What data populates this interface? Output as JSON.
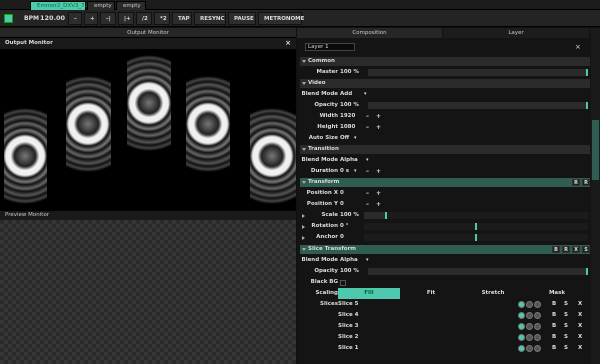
{
  "tabs": [
    {
      "label": "Emmer2_DXV3_720p",
      "active": true
    },
    {
      "label": "empty"
    },
    {
      "label": "empty"
    }
  ],
  "transport": {
    "bpm_label": "BPM",
    "bpm": "120.00",
    "minus": "–",
    "plus": "+",
    "decrement": "–|",
    "increment": "|+",
    "half": "/2",
    "double": "*2",
    "tap": "TAP",
    "resync": "RESYNC",
    "pause": "PAUSE",
    "metronome": "METRONOME"
  },
  "output": {
    "header": "Output Monitor",
    "panel_title": "Output Monitor",
    "close": "×",
    "preview": "Preview Monitor"
  },
  "panel": {
    "tab_composition": "Composition",
    "tab_layer": "Layer",
    "layer_name": "Layer 1",
    "close": "×"
  },
  "common": {
    "title": "Common",
    "master_label": "Master",
    "master_value": "100 %"
  },
  "video": {
    "title": "Video",
    "blend_mode_label": "Blend Mode",
    "blend_mode": "Add",
    "opacity_label": "Opacity",
    "opacity": "100 %",
    "width_label": "Width",
    "width": "1920",
    "height_label": "Height",
    "height": "1080",
    "autosize_label": "Auto Size",
    "autosize": "Off"
  },
  "transition": {
    "title": "Transition",
    "blend_mode_label": "Blend Mode",
    "blend_mode": "Alpha",
    "duration_label": "Duration",
    "duration": "0 s"
  },
  "transform": {
    "title": "Transform",
    "btn_r1": "R",
    "btn_r2": "R",
    "posx_label": "Position X",
    "posx": "0",
    "posy_label": "Position Y",
    "posy": "0",
    "scale_label": "Scale",
    "scale": "100 %",
    "rotation_label": "Rotation",
    "rotation": "0 °",
    "anchor_label": "Anchor",
    "anchor": "0"
  },
  "slice_transform": {
    "title": "Slice Transform",
    "btn_b": "B",
    "btn_r": "R",
    "btn_x": "X",
    "btn_s": "S",
    "blend_mode_label": "Blend Mode",
    "blend_mode": "Alpha",
    "opacity_label": "Opacity",
    "opacity": "100 %",
    "blackbg_label": "Black BG",
    "scaling_label": "Scaling",
    "scaling_fill": "Fill",
    "scaling_fit": "Fit",
    "scaling_stretch": "Stretch",
    "mask_label": "Mask",
    "slices_label": "Slices",
    "slices": [
      "Slice 5",
      "Slice 4",
      "Slice 3",
      "Slice 2",
      "Slice 1"
    ]
  },
  "plus": "+",
  "minus": "–",
  "caret": "▾",
  "b": "B",
  "s": "S",
  "x": "X",
  "colors": {
    "accent": "#4fc9ad",
    "section_green": "#2f5d52"
  }
}
